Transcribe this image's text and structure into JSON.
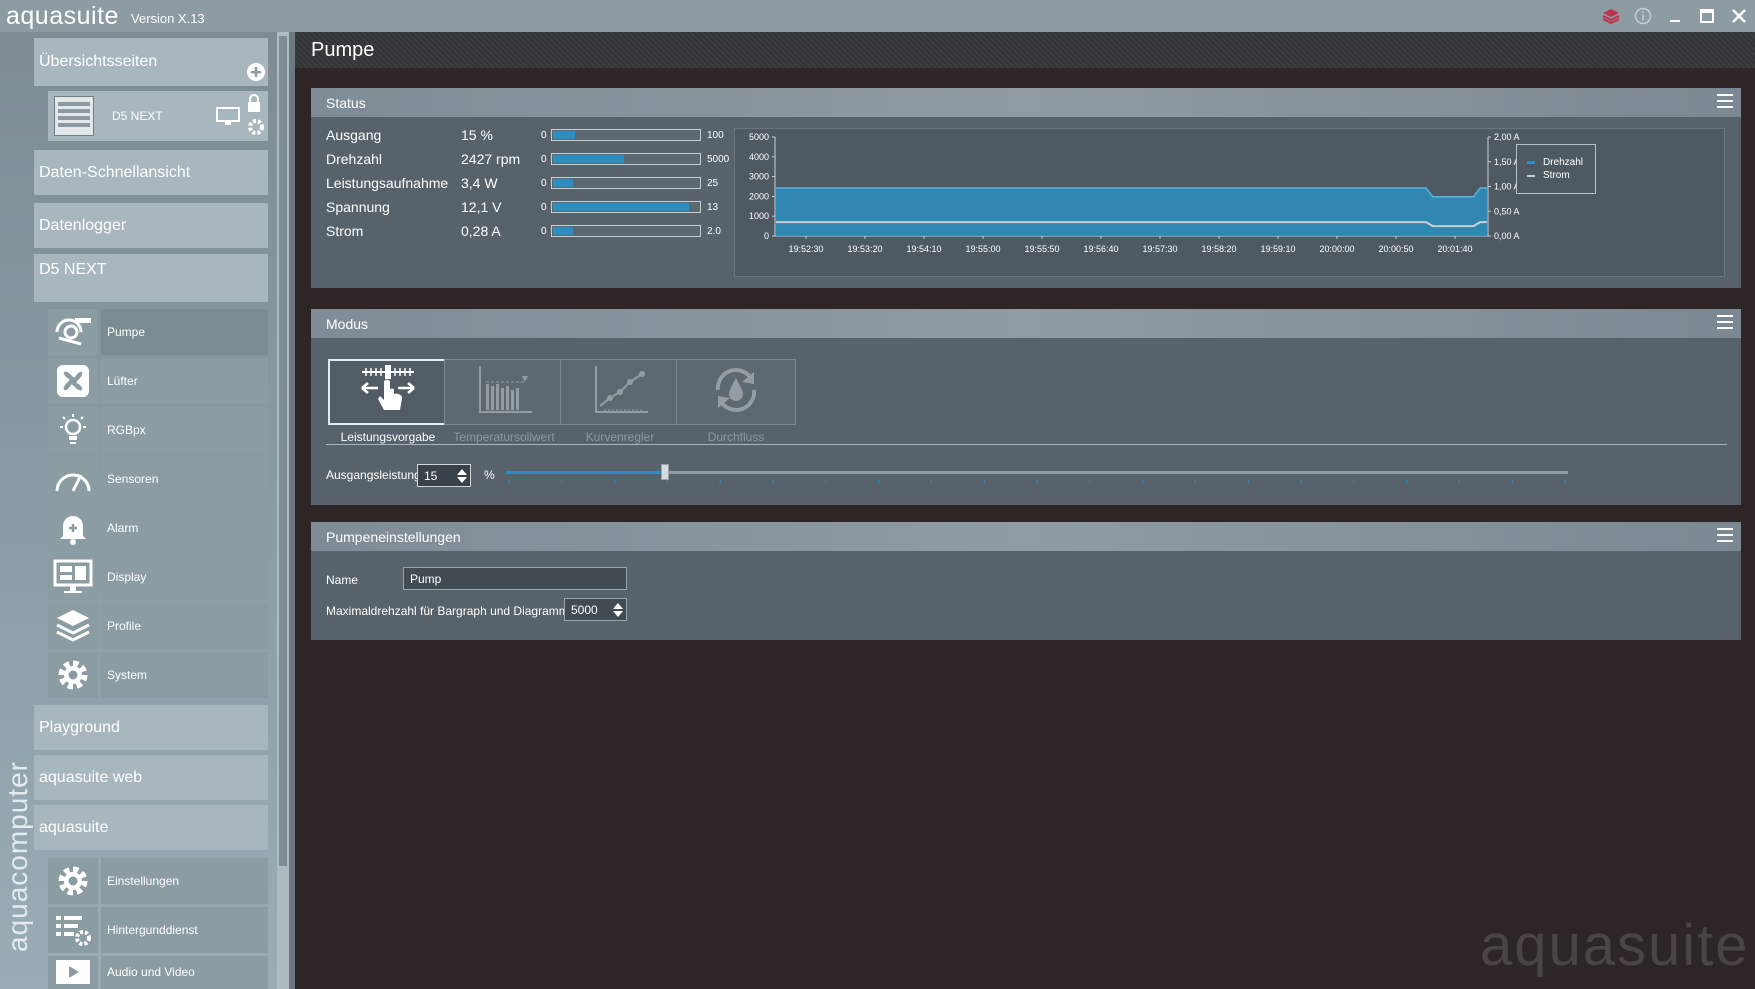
{
  "titlebar": {
    "app": "aquasuite",
    "version": "Version X.13"
  },
  "sidebar": {
    "brand": "aquacomputer",
    "sections": {
      "overview": "Übersichtsseiten",
      "device_tile": "D5 NEXT",
      "quickview": "Daten-Schnellansicht",
      "logger": "Datenlogger",
      "device": "D5 NEXT",
      "playground": "Playground",
      "web": "aquasuite web",
      "aquasuite": "aquasuite"
    },
    "device_items": [
      "Pumpe",
      "Lüfter",
      "RGBpx",
      "Sensoren",
      "Alarm",
      "Display",
      "Profile",
      "System"
    ],
    "aquasuite_items": [
      "Einstellungen",
      "Hintergunddienst",
      "Audio und Video"
    ]
  },
  "page": {
    "title": "Pumpe"
  },
  "status": {
    "title": "Status",
    "rows": [
      {
        "label": "Ausgang",
        "value": "15 %",
        "min": "0",
        "max": "100",
        "level": 0.15
      },
      {
        "label": "Drehzahl",
        "value": "2427 rpm",
        "min": "0",
        "max": "5000",
        "level": 0.485
      },
      {
        "label": "Leistungsaufnahme",
        "value": "3,4 W",
        "min": "0",
        "max": "25",
        "level": 0.136
      },
      {
        "label": "Spannung",
        "value": "12,1 V",
        "min": "0",
        "max": "13",
        "level": 0.93
      },
      {
        "label": "Strom",
        "value": "0,28 A",
        "min": "0",
        "max": "2.0",
        "level": 0.14
      }
    ]
  },
  "chart_data": {
    "type": "area",
    "x": [
      "19:52:30",
      "19:53:20",
      "19:54:10",
      "19:55:00",
      "19:55:50",
      "19:56:40",
      "19:57:30",
      "19:58:20",
      "19:59:10",
      "20:00:00",
      "20:00:50",
      "20:01:40"
    ],
    "y_left_ticks": [
      "5000",
      "4000",
      "3000",
      "2000",
      "1000",
      "0"
    ],
    "y_right_ticks": [
      "2,00 A",
      "1,50 A",
      "1,00 A",
      "0,50 A",
      "0,00 A"
    ],
    "ylim_left": [
      0,
      5000
    ],
    "ylim_right": [
      0,
      2.0
    ],
    "series": [
      {
        "name": "Drehzahl",
        "axis": "left",
        "color": "#2a8fc0",
        "values": [
          2427,
          2427,
          2427,
          2427,
          2427,
          2427,
          2427,
          2427,
          2427,
          2427,
          2427,
          2427,
          2427,
          2427,
          2427,
          2427,
          2427,
          2427,
          2427,
          2427,
          2427,
          2427,
          2427,
          2427,
          2427,
          2427,
          2427,
          2427,
          2427,
          2427,
          2427,
          2427,
          2427,
          2427,
          2427,
          2427,
          2427,
          2427,
          2427,
          2427,
          2427,
          2427,
          2427,
          2427,
          2427,
          2427,
          2427,
          2427,
          2427,
          2427,
          2427,
          2427,
          2427,
          2427,
          2427,
          2427,
          2427,
          2427,
          2427,
          2427,
          2427,
          2427,
          2427,
          2427,
          2427,
          2427,
          2427,
          2427,
          2427,
          2427,
          2427,
          2427,
          2427,
          2427,
          2427,
          2427,
          2427,
          2427,
          2427,
          2427,
          2427,
          2427,
          2427,
          2427,
          2427,
          2427,
          2427,
          2427,
          2427,
          2427,
          2427,
          2427,
          2427,
          2427,
          2427,
          2427,
          2427,
          1980,
          1980,
          1980,
          1980,
          1980,
          1980,
          1980,
          2427,
          2427
        ]
      },
      {
        "name": "Strom",
        "axis": "right",
        "color": "#c8d0d4",
        "values": [
          0.28,
          0.28,
          0.28,
          0.28,
          0.28,
          0.28,
          0.28,
          0.28,
          0.28,
          0.28,
          0.28,
          0.28,
          0.28,
          0.28,
          0.28,
          0.28,
          0.28,
          0.28,
          0.28,
          0.28,
          0.28,
          0.28,
          0.28,
          0.28,
          0.28,
          0.28,
          0.28,
          0.28,
          0.28,
          0.28,
          0.28,
          0.28,
          0.28,
          0.28,
          0.28,
          0.28,
          0.28,
          0.28,
          0.28,
          0.28,
          0.28,
          0.28,
          0.28,
          0.28,
          0.28,
          0.28,
          0.28,
          0.28,
          0.28,
          0.28,
          0.28,
          0.28,
          0.28,
          0.28,
          0.28,
          0.28,
          0.28,
          0.28,
          0.28,
          0.28,
          0.28,
          0.28,
          0.28,
          0.28,
          0.28,
          0.28,
          0.28,
          0.28,
          0.28,
          0.28,
          0.28,
          0.28,
          0.28,
          0.28,
          0.28,
          0.28,
          0.28,
          0.28,
          0.28,
          0.28,
          0.28,
          0.28,
          0.28,
          0.28,
          0.28,
          0.28,
          0.28,
          0.28,
          0.28,
          0.28,
          0.28,
          0.28,
          0.28,
          0.28,
          0.28,
          0.28,
          0.28,
          0.2,
          0.2,
          0.2,
          0.2,
          0.2,
          0.2,
          0.2,
          0.28,
          0.28
        ]
      }
    ],
    "legend": [
      "Drehzahl",
      "Strom"
    ],
    "legend_position": "top-right"
  },
  "modus": {
    "title": "Modus",
    "modes": [
      {
        "label": "Leistungsvorgabe",
        "icon": "power-slider-icon",
        "selected": true
      },
      {
        "label": "Temperatursollwert",
        "icon": "temperature-bars-icon",
        "selected": false
      },
      {
        "label": "Kurvenregler",
        "icon": "curve-icon",
        "selected": false
      },
      {
        "label": "Durchfluss",
        "icon": "flow-drop-icon",
        "selected": false
      }
    ],
    "output": {
      "label": "Ausgangsleistung",
      "value": "15",
      "unit": "%",
      "level": 0.15
    }
  },
  "settings": {
    "title": "Pumpeneinstellungen",
    "name_label": "Name",
    "name_value": "Pump",
    "maxrpm_label": "Maximaldrehzahl für Bargraph und Diagramm",
    "maxrpm_value": "5000"
  },
  "watermark": "aquasuite",
  "colors": {
    "accent": "#2a8fc0",
    "panel": "#57626b",
    "sidebar": "#8c9ca3",
    "close": "#c0304a"
  }
}
